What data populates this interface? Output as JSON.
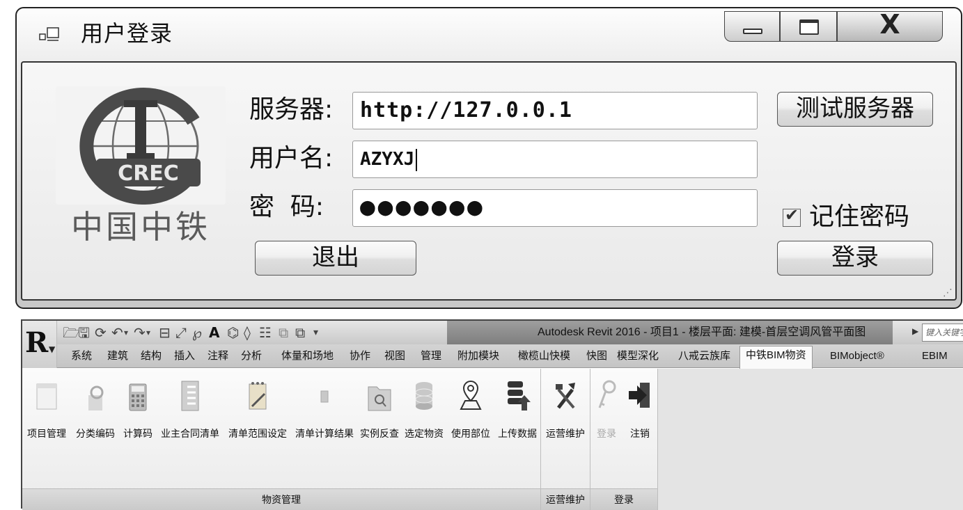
{
  "login_dialog": {
    "title": "用户登录",
    "close_glyph": "X",
    "logo": {
      "emblem_text": "CREC",
      "caption": "中国中铁"
    },
    "server_label": "服务器:",
    "server_value": "http://127.0.0.1",
    "username_label": "用户名:",
    "username_value": "AZYXJ",
    "password_label": "密  码:",
    "password_mask": "●●●●●●●",
    "test_server_button": "测试服务器",
    "remember_password_label": "记住密码",
    "remember_password_checked": true,
    "exit_button": "退出",
    "login_button": "登录"
  },
  "revit": {
    "window_title": "Autodesk Revit 2016 -    项目1 - 楼层平面: 建模-首层空调风管平面图",
    "search_placeholder": "键入关键字或",
    "tabs": [
      {
        "label": "系统"
      },
      {
        "label": "建筑"
      },
      {
        "label": "结构"
      },
      {
        "label": "插入"
      },
      {
        "label": "注释"
      },
      {
        "label": "分析"
      },
      {
        "label": "体量和场地"
      },
      {
        "label": "协作"
      },
      {
        "label": "视图"
      },
      {
        "label": "管理"
      },
      {
        "label": "附加模块"
      },
      {
        "label": "橄榄山快模"
      },
      {
        "label": "快图"
      },
      {
        "label": "模型深化"
      },
      {
        "label": "八戒云族库"
      },
      {
        "label": "中铁BIM物资"
      },
      {
        "label": "BIMobject®"
      },
      {
        "label": "EBIM"
      }
    ],
    "active_tab": "中铁BIM物资",
    "panels": {
      "materials": {
        "title": "物资管理",
        "buttons": [
          {
            "label": "项目管理",
            "icon": "project-icon"
          },
          {
            "label": "分类编码",
            "icon": "classification-icon"
          },
          {
            "label": "计算码",
            "icon": "calculator-icon"
          },
          {
            "label": "业主合同清单",
            "icon": "list-icon"
          },
          {
            "label": "清单范围设定",
            "icon": "notepad-icon"
          },
          {
            "label": "清单计算结果",
            "icon": "result-icon"
          },
          {
            "label": "实例反查",
            "icon": "folder-search-icon"
          },
          {
            "label": "选定物资",
            "icon": "database-icon"
          },
          {
            "label": "使用部位",
            "icon": "location-pin-icon"
          },
          {
            "label": "上传数据",
            "icon": "upload-database-icon"
          }
        ]
      },
      "operations": {
        "title": "运营维护",
        "buttons": [
          {
            "label": "运营维护",
            "icon": "tools-icon"
          }
        ]
      },
      "login": {
        "title": "登录",
        "buttons": [
          {
            "label": "登录",
            "icon": "key-icon",
            "disabled": true
          },
          {
            "label": "注销",
            "icon": "logout-icon"
          }
        ]
      }
    }
  }
}
